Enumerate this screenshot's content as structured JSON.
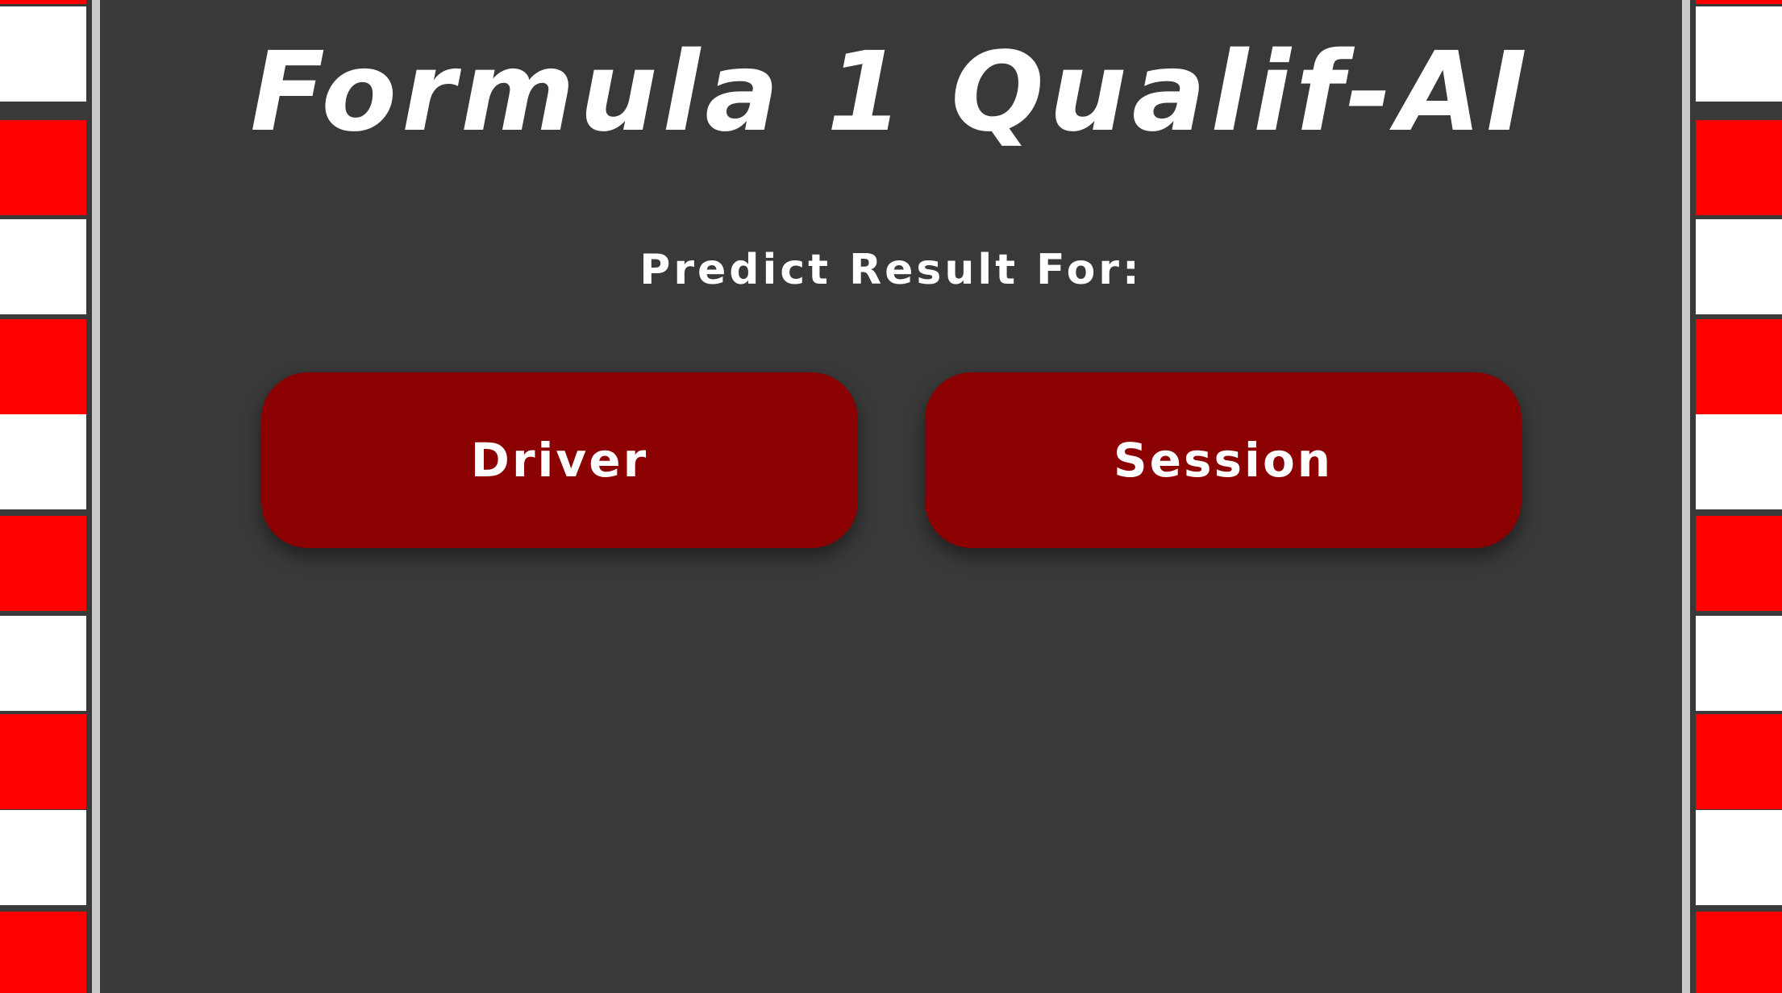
{
  "header": {
    "title": "Formula 1 Qualif-AI",
    "subtitle": "Predict Result For:"
  },
  "options": {
    "driver_label": "Driver",
    "session_label": "Session"
  },
  "colors": {
    "background": "#393939",
    "button": "#8b0000",
    "curb_red": "#ff0000",
    "curb_white": "#ffffff",
    "text": "#ffffff"
  }
}
